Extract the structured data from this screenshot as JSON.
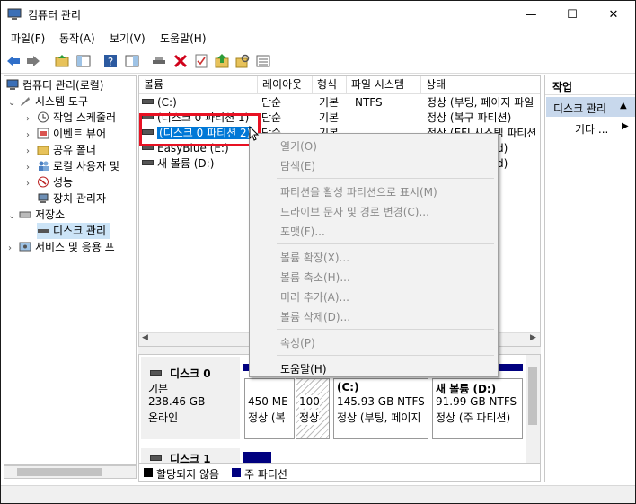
{
  "window": {
    "title": "컴퓨터 관리",
    "controls": {
      "minimize": "—",
      "maximize": "☐",
      "close": "✕"
    }
  },
  "menu": [
    "파일(F)",
    "동작(A)",
    "보기(V)",
    "도움말(H)"
  ],
  "tree": {
    "root": "컴퓨터 관리(로컬)",
    "system_tools": "시스템 도구",
    "items": [
      "작업 스케줄러",
      "이벤트 뷰어",
      "공유 폴더",
      "로컬 사용자 및",
      "성능",
      "장치 관리자"
    ],
    "storage": "저장소",
    "disk_mgmt": "디스크 관리",
    "services": "서비스 및 응용 프"
  },
  "volume_list": {
    "columns": [
      "볼륨",
      "레이아웃",
      "형식",
      "파일 시스템",
      "상태"
    ],
    "rows": [
      {
        "name": "(C:)",
        "layout": "단순",
        "type": "기본",
        "fs": "NTFS",
        "status": "정상 (부팅, 페이지 파일"
      },
      {
        "name": "(디스크 0 파티션 1)",
        "layout": "단순",
        "type": "기본",
        "fs": "",
        "status": "정상 (복구 파티션)"
      },
      {
        "name": "(디스크 0 파티션 2)",
        "layout": "단순",
        "type": "기본",
        "fs": "",
        "status": "정상 (EFI 시스템 파티션"
      },
      {
        "name": "EasyBlue (E:)",
        "layout": "",
        "type": "",
        "fs": "",
        "status": ""
      },
      {
        "name": "새 볼륨 (D:)",
        "layout": "",
        "type": "",
        "fs": "",
        "status": ""
      }
    ],
    "partial_right": [
      "",
      "",
      "",
      "d)",
      "d)"
    ]
  },
  "disks": {
    "disk0": {
      "label": "디스크 0",
      "kind": "기본",
      "size": "238.46 GB",
      "state": "온라인",
      "partitions": [
        {
          "size": "450 ME",
          "status": "정상 (복"
        },
        {
          "size": "100",
          "status": "정상"
        },
        {
          "name": "(C:)",
          "size": "145.93 GB NTFS",
          "status": "정상 (부팅, 페이지"
        },
        {
          "name": "새 볼륨  (D:)",
          "size": "91.99 GB NTFS",
          "status": "정상 (주 파티션)"
        }
      ]
    },
    "disk1": {
      "label": "디스크 1"
    }
  },
  "legend": {
    "unallocated": "할당되지 않음",
    "primary": "주 파티션"
  },
  "actions": {
    "header": "작업",
    "section": "디스크 관리",
    "more": "기타 ..."
  },
  "context_menu": {
    "items": [
      {
        "label": "열기(O)",
        "enabled": false
      },
      {
        "label": "탐색(E)",
        "enabled": false
      },
      {
        "label": "파티션을 활성 파티션으로 표시(M)",
        "enabled": false
      },
      {
        "label": "드라이브 문자 및 경로 변경(C)...",
        "enabled": false
      },
      {
        "label": "포맷(F)...",
        "enabled": false
      },
      {
        "label": "볼륨 확장(X)...",
        "enabled": false
      },
      {
        "label": "볼륨 축소(H)...",
        "enabled": false
      },
      {
        "label": "미러 추가(A)...",
        "enabled": false
      },
      {
        "label": "볼륨 삭제(D)...",
        "enabled": false
      },
      {
        "label": "속성(P)",
        "enabled": false
      },
      {
        "label": "도움말(H)",
        "enabled": true
      }
    ]
  },
  "colors": {
    "selection": "#0078d7",
    "highlight_box": "#e81123",
    "primary_partition": "#00007f",
    "actions_header": "#c8d8ec"
  }
}
